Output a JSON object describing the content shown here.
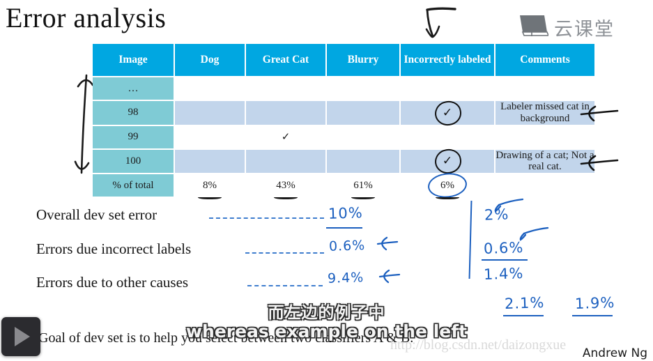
{
  "slide": {
    "title": "Error analysis",
    "footer_sentence": "Goal of dev set is to help you select between two classifiers A & B.",
    "author": "Andrew Ng",
    "watermark": "http://blog.csdn.net/daizongxue",
    "accent_header": "#00A7E1",
    "accent_imagecol": "#7FCBD5",
    "accent_datacell": "#C2D5EB",
    "pen_blue": "#1B5FBF",
    "pen_black": "#111111"
  },
  "logo": {
    "text": "云课堂",
    "icon": "monitor-icon"
  },
  "table": {
    "headers": [
      "Image",
      "Dog",
      "Great Cat",
      "Blurry",
      "Incorrectly labeled",
      "Comments"
    ],
    "rows": [
      {
        "image": "…",
        "dog": "",
        "great_cat": "",
        "blurry": "",
        "incorrectly_labeled": "",
        "comments": "",
        "style": "empty"
      },
      {
        "image": "98",
        "dog": "",
        "great_cat": "",
        "blurry": "",
        "incorrectly_labeled": "✓",
        "comments": "Labeler missed cat in background",
        "style": "shaded"
      },
      {
        "image": "99",
        "dog": "",
        "great_cat": "✓",
        "blurry": "",
        "incorrectly_labeled": "",
        "comments": "",
        "style": "plain"
      },
      {
        "image": "100",
        "dog": "",
        "great_cat": "",
        "blurry": "",
        "incorrectly_labeled": "✓",
        "comments": "Drawing of a cat; Not a real cat.",
        "style": "shaded"
      }
    ],
    "totals": {
      "label": "% of total",
      "dog": "8%",
      "great_cat": "43%",
      "blurry": "61%",
      "incorrectly_labeled": "6%",
      "comments": ""
    }
  },
  "bullets": [
    {
      "label": "Overall dev set error",
      "value": "10%"
    },
    {
      "label": "Errors due incorrect labels",
      "value": "0.6%"
    },
    {
      "label": "Errors due to other causes",
      "value": "9.4%"
    }
  ],
  "right_column": {
    "values": [
      "2%",
      "0.6%",
      "1.4%"
    ]
  },
  "bottom_values": {
    "left": "2.1%",
    "right": "1.9%"
  },
  "subtitles": {
    "chinese": "而左边的例子中",
    "english": "whereas example on the left"
  },
  "player": {
    "play_label": "play-button"
  }
}
